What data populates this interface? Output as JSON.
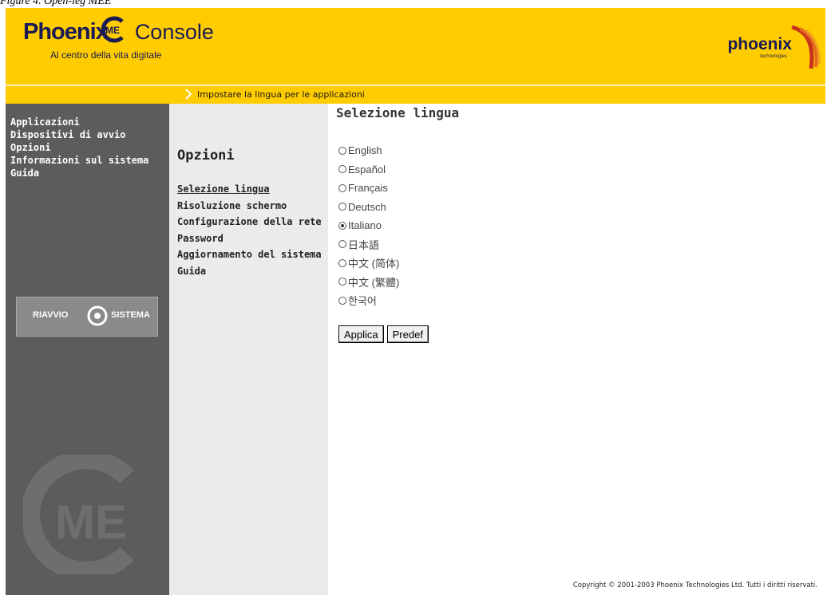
{
  "caption": "Figure 4. Open-leg MEE",
  "header": {
    "brand_phoenix": "Phoenix",
    "brand_badge": "ME",
    "brand_console": "Console",
    "tagline": "Al centro della vita digitale",
    "corp_name": "phoenix",
    "corp_sub": "technologies",
    "colors": {
      "bar": "#ffcc00",
      "brand": "#1a1a55"
    }
  },
  "breadcrumb": {
    "text": "Impostare la lingua per le applicazioni"
  },
  "leftnav": {
    "items": [
      {
        "label": "Applicazioni"
      },
      {
        "label": "Dispositivi di avvio"
      },
      {
        "label": "Opzioni"
      },
      {
        "label": "Informazioni sul sistema"
      },
      {
        "label": "Guida"
      }
    ],
    "restart": {
      "left": "RIAVVIO",
      "right": "SISTEMA"
    },
    "watermark": "ME"
  },
  "subnav": {
    "title": "Opzioni",
    "items": [
      {
        "label": "Selezione lingua"
      },
      {
        "label": "Risoluzione schermo"
      },
      {
        "label": "Configurazione della rete"
      },
      {
        "label": "Password"
      },
      {
        "label": "Aggiornamento del sistema"
      },
      {
        "label": "Guida"
      }
    ]
  },
  "content": {
    "title": "Selezione lingua",
    "languages": [
      {
        "label": "English",
        "selected": false
      },
      {
        "label": "Español",
        "selected": false
      },
      {
        "label": "Français",
        "selected": false
      },
      {
        "label": "Deutsch",
        "selected": false
      },
      {
        "label": "Italiano",
        "selected": true
      },
      {
        "label": "日本語",
        "selected": false
      },
      {
        "label": "中文 (简体)",
        "selected": false
      },
      {
        "label": "中文 (繁體)",
        "selected": false
      },
      {
        "label": "한국어",
        "selected": false
      }
    ],
    "apply_label": "Applica",
    "default_label": "Predef"
  },
  "footer": {
    "copyright": "Copyright © 2001-2003 Phoenix Technologies Ltd. Tutti i diritti riservati."
  }
}
